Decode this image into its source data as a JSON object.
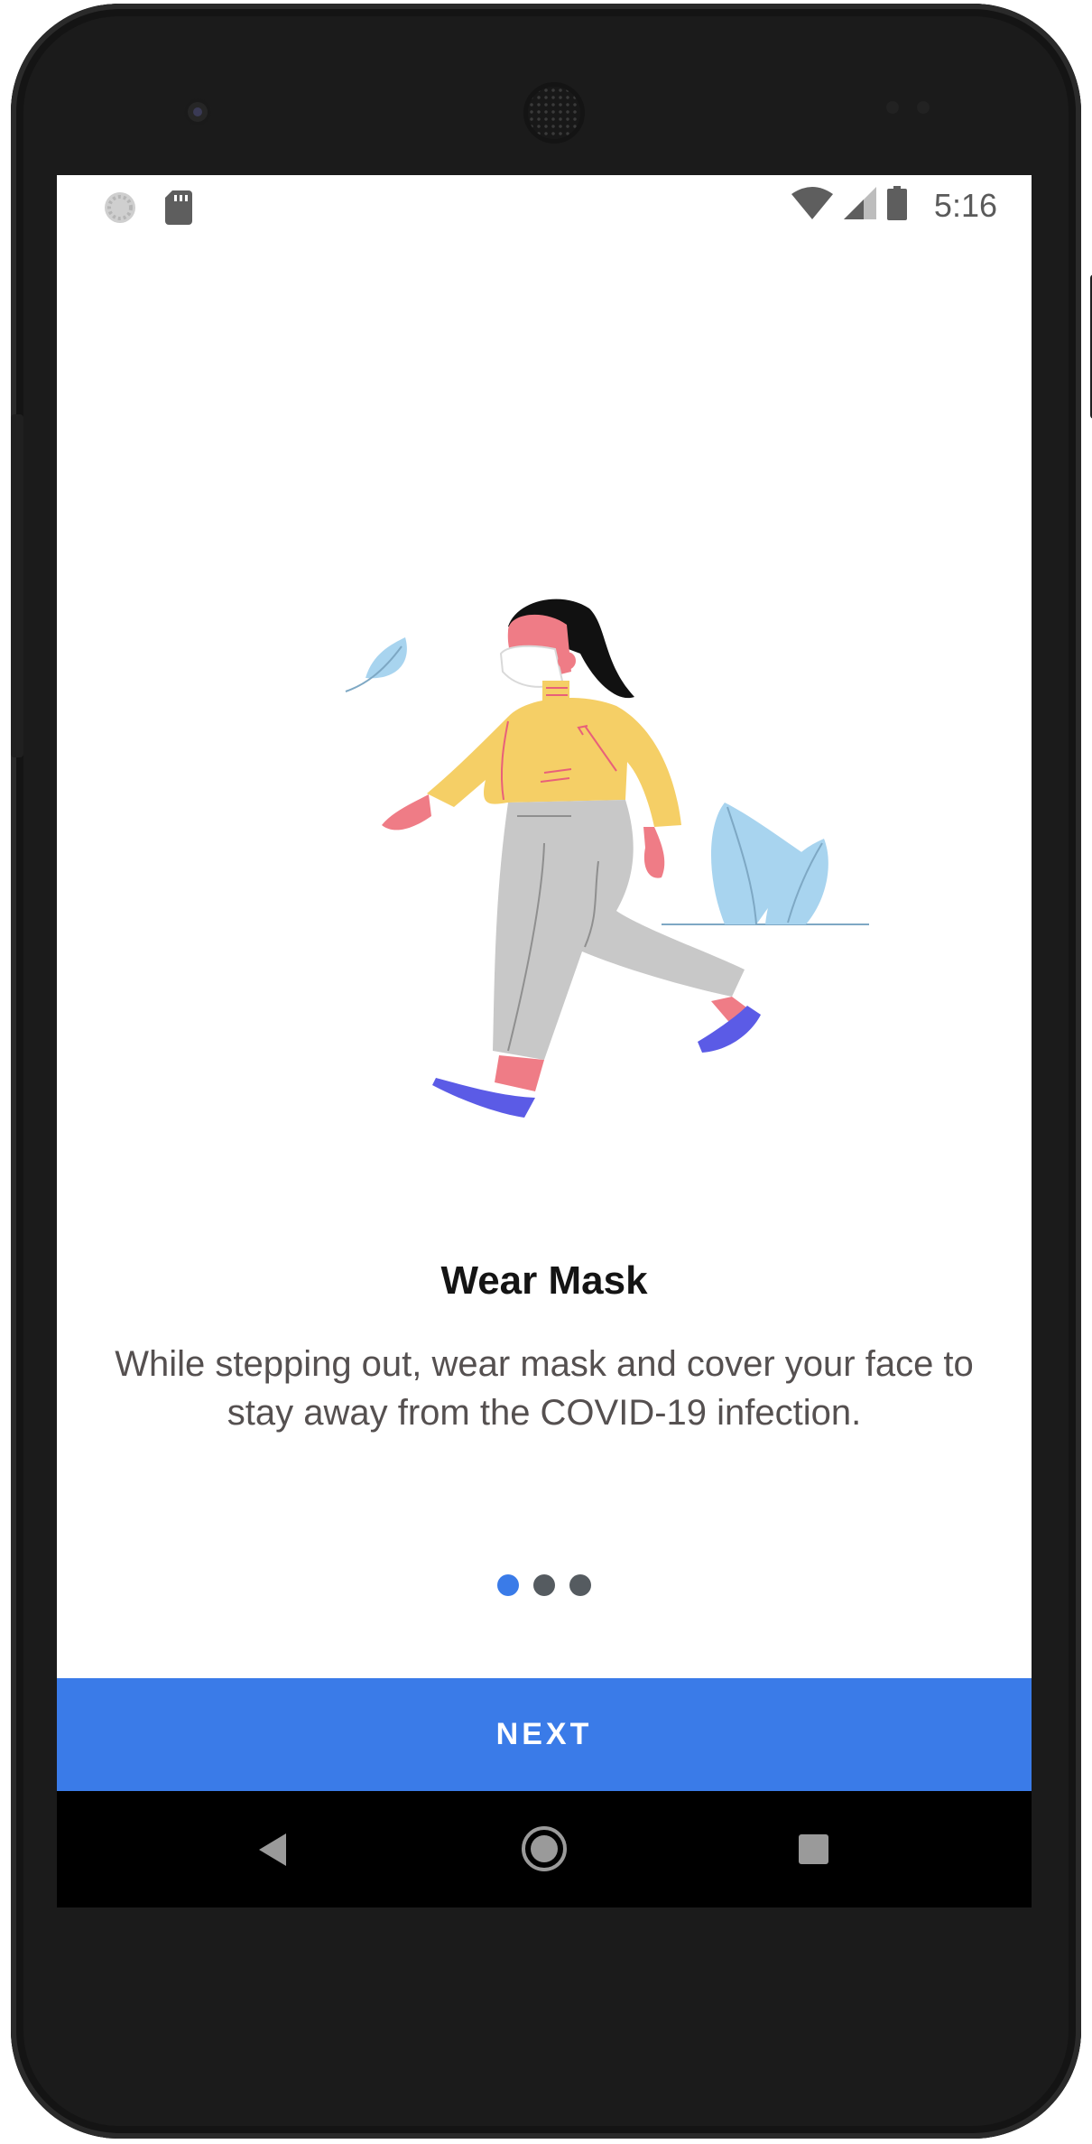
{
  "status_bar": {
    "time": "5:16",
    "left_icons": [
      "sync-icon",
      "sd-card-icon"
    ],
    "right_icons": [
      "wifi-icon",
      "cell-signal-icon",
      "battery-icon"
    ]
  },
  "onboarding": {
    "title": "Wear Mask",
    "description": "While stepping out, wear mask and cover your face to stay away from the COVID-19 infection.",
    "page_indicator": {
      "current": 1,
      "total": 3
    }
  },
  "next_button": {
    "label": "NEXT"
  },
  "nav_bar": {
    "icons": [
      "back-icon",
      "home-icon",
      "recents-icon"
    ]
  },
  "colors": {
    "accent": "#3a7be8",
    "title_text": "#141414",
    "body_text": "#555050",
    "inactive_dot": "#555b60",
    "sweater": "#f5cf66",
    "trousers": "#c8c8c8",
    "skin": "#ef7c86",
    "shoes": "#5b5be6",
    "leaf": "#a8d4ef"
  }
}
